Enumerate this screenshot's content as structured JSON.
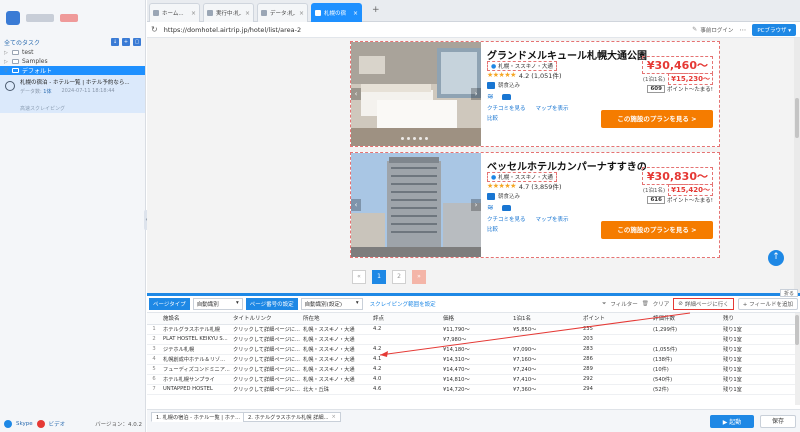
{
  "sidebar": {
    "all_tasks": "全てのタスク",
    "tree": [
      {
        "label": "test",
        "caret": "▷"
      },
      {
        "label": "Samples",
        "caret": "▷"
      },
      {
        "label": "デフォルト",
        "caret": "▽"
      }
    ],
    "task": {
      "name": "札幌の宿泊 - ホテル一覧 | ホテル予約なら...",
      "count_label": "データ数",
      "count_value": "1体",
      "date": "2024-07-11 18:18:44",
      "sub": "高速スクレイピング"
    },
    "footer": {
      "skype": "Skype",
      "video": "ビデオ",
      "version": "バージョン：4.0.2"
    }
  },
  "browser": {
    "tabs": [
      {
        "label": "ホーム...",
        "active": false
      },
      {
        "label": "実行中:札...",
        "active": false
      },
      {
        "label": "データ:札...",
        "active": false
      },
      {
        "label": "札幌の宿",
        "active": true
      }
    ],
    "new_tab": "+",
    "url": "https://domhotel.airtrip.jp/hotel/list/area-2",
    "login": "事前ログイン",
    "pc_browser": "PCブラウザ ▾"
  },
  "hotels": [
    {
      "name": "グランドメルキュール札幌大通公園",
      "area": "札幌・ススキノ・大通",
      "stars": "★★★★★",
      "score": "4.2 (1,051件)",
      "amenity": "朝食込み",
      "links": [
        "クチコミを見る",
        "マップを表示"
      ],
      "compare": "比較",
      "price": "¥30,460～",
      "per_person_label": "(1泊1名)",
      "per_person": "¥15,230～",
      "points": "609",
      "points_label": "ポイント～たまる!",
      "plan_button": "この施設のプランを見る >"
    },
    {
      "name": "ベッセルホテルカンパーナすすきの",
      "area": "札幌・ススキノ・大通",
      "stars": "★★★★★",
      "score": "4.7 (3,859件)",
      "amenity": "朝食込み",
      "links": [
        "クチコミを見る",
        "マップを表示"
      ],
      "compare": "比較",
      "price": "¥30,830～",
      "per_person_label": "(1泊1名)",
      "per_person": "¥15,420～",
      "points": "616",
      "points_label": "ポイント～たまる!",
      "plan_button": "この施設のプランを見る >"
    }
  ],
  "pager": {
    "prev": "«",
    "pages": [
      "1",
      "2"
    ],
    "next": "»"
  },
  "panel": {
    "fold": "折る",
    "page_type_label": "ページタイプ",
    "page_type_value": "自動識別",
    "paging_label": "ページ番号の設定",
    "paging_value": "自動識別(設定)",
    "scrape_range": "スクレイピング範囲を設定",
    "filter": "フィルター",
    "clear": "クリア",
    "goto_detail": "詳細ページに行く",
    "add_field": "+ フィールドを追加",
    "columns": [
      "",
      "施設名",
      "タイトルリンク",
      "所在地",
      "評点",
      "価格",
      "1泊1名",
      "ポイント",
      "評価件数",
      "残り"
    ],
    "rows": [
      [
        "1",
        "ホテルグラスホテル札幌",
        "クリックして詳細ページに...",
        "札幌・ススキノ・大通",
        "4.2",
        "¥11,790～",
        "¥5,850～",
        "235",
        "(1,299件)",
        "残り1室"
      ],
      [
        "2",
        "PLAT HOSTEL KEIKYU S...",
        "クリックして詳細ページに...",
        "札幌・ススキノ・大通",
        "",
        "¥7,980～",
        "",
        "203",
        "",
        "残り1室"
      ],
      [
        "3",
        "ジテホル札幌",
        "クリックして詳細ページに...",
        "札幌・ススキノ・大通",
        "4.2",
        "¥14,180～",
        "¥7,090～",
        "283",
        "(1,055件)",
        "残り1室"
      ],
      [
        "4",
        "札幌創成中ホテル＆リゾ...",
        "クリックして詳細ページに...",
        "札幌・ススキノ・大通",
        "4.1",
        "¥14,310～",
        "¥7,160～",
        "286",
        "(138件)",
        "残り1室"
      ],
      [
        "5",
        "フューディズコンドミニア...",
        "クリックして詳細ページに...",
        "札幌・ススキノ・大通",
        "4.2",
        "¥14,470～",
        "¥7,240～",
        "289",
        "(10件)",
        "残り1室"
      ],
      [
        "6",
        "ホテル札幌サンプライ",
        "クリックして詳細ページに...",
        "札幌・ススキノ・大通",
        "4.0",
        "¥14,810～",
        "¥7,410～",
        "292",
        "(540件)",
        "残り1室"
      ],
      [
        "7",
        "UNTAPPED HOSTEL",
        "クリックして詳細ページに...",
        "北大・丘珠",
        "4.6",
        "¥14,720～",
        "¥7,360～",
        "294",
        "(52件)",
        "残り1室"
      ]
    ],
    "bottom_tabs": [
      "1. 札幌の宿泊 - ホテル一覧 | ホテ...",
      "2. ホテルグラスホテル札幌 詳細..."
    ],
    "run": "▶ 起動",
    "save": "保存"
  }
}
